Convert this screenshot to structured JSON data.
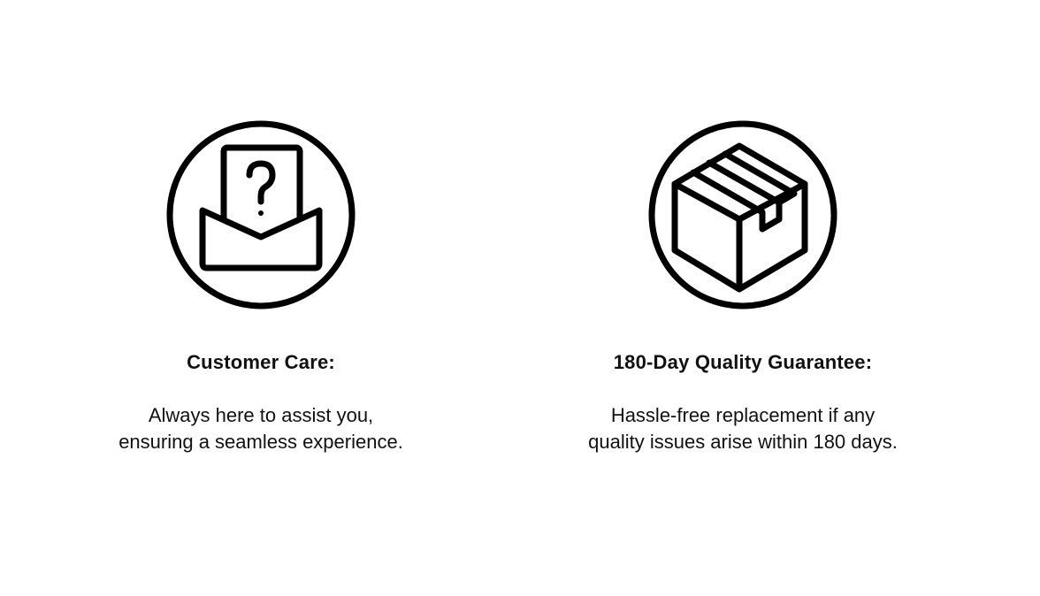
{
  "features": [
    {
      "icon": "customer-support-envelope-icon",
      "title": "Customer Care:",
      "description_lines": [
        "Always here to assist you,",
        "ensuring a seamless experience."
      ]
    },
    {
      "icon": "package-box-icon",
      "title": "180-Day Quality Guarantee:",
      "description_lines": [
        "Hassle-free replacement if any",
        "quality issues arise within 180 days."
      ]
    }
  ],
  "colors": {
    "icon_stroke": "#000000",
    "text": "#111111",
    "background": "#ffffff"
  }
}
